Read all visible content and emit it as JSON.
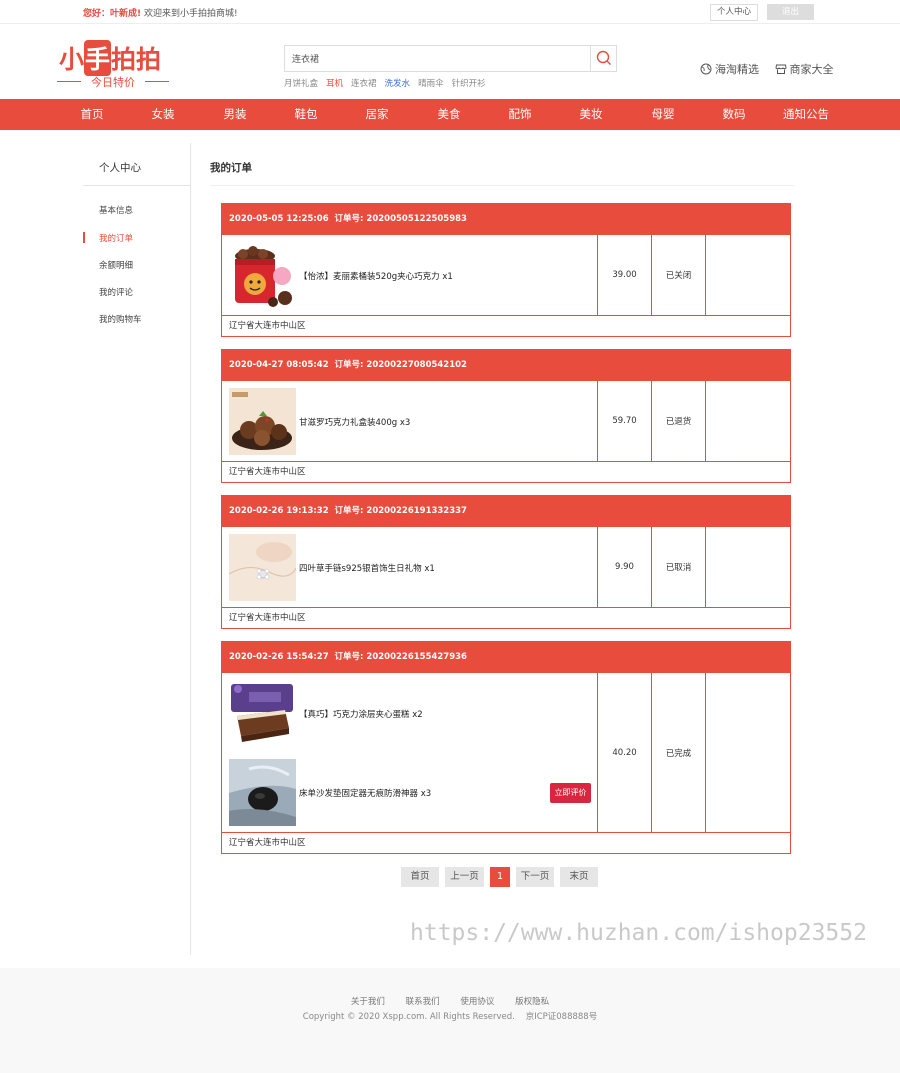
{
  "topbar": {
    "hello": "您好：叶新成!",
    "welcome": "欢迎来到小手拍拍商城!",
    "user_center": "个人中心",
    "logout": "退出"
  },
  "logo": {
    "pre": "小",
    "box": "手",
    "post": "拍拍",
    "sub": "今日特价"
  },
  "search": {
    "value": "连衣裙",
    "hotwords": [
      "月饼礼盒",
      "耳机",
      "连衣裙",
      "洗发水",
      "晴雨伞",
      "针织开衫"
    ]
  },
  "header_links": [
    "海淘精选",
    "商家大全"
  ],
  "nav": [
    "首页",
    "女装",
    "男装",
    "鞋包",
    "居家",
    "美食",
    "配饰",
    "美妆",
    "母婴",
    "数码",
    "通知公告"
  ],
  "sidebar": {
    "title": "个人中心",
    "items": [
      "基本信息",
      "我的订单",
      "余额明细",
      "我的评论",
      "我的购物车"
    ]
  },
  "main": {
    "title": "我的订单"
  },
  "orders": [
    {
      "datetime": "2020-05-05 12:25:06",
      "order_label": "订单号:",
      "order_no": "20200505122505983",
      "items": [
        {
          "name": "【怡浓】麦丽素桶装520g夹心巧克力 x1"
        }
      ],
      "price": "39.00",
      "status": "已关闭",
      "address": "辽宁省大连市中山区"
    },
    {
      "datetime": "2020-04-27 08:05:42",
      "order_label": "订单号:",
      "order_no": "20200227080542102",
      "items": [
        {
          "name": "甘滋罗巧克力礼盒装400g x3"
        }
      ],
      "price": "59.70",
      "status": "已退货",
      "address": "辽宁省大连市中山区"
    },
    {
      "datetime": "2020-02-26 19:13:32",
      "order_label": "订单号:",
      "order_no": "20200226191332337",
      "items": [
        {
          "name": "四叶草手链s925银首饰生日礼物 x1"
        }
      ],
      "price": "9.90",
      "status": "已取消",
      "address": "辽宁省大连市中山区"
    },
    {
      "datetime": "2020-02-26 15:54:27",
      "order_label": "订单号:",
      "order_no": "20200226155427936",
      "items": [
        {
          "name": "【真巧】巧克力涂层夹心蛋糕 x2"
        },
        {
          "name": "床单沙发垫固定器无痕防滑神器 x3",
          "review": "立即评价"
        }
      ],
      "price": "40.20",
      "status": "已完成",
      "address": "辽宁省大连市中山区"
    }
  ],
  "pagination": {
    "first": "首页",
    "prev": "上一页",
    "current": "1",
    "next": "下一页",
    "last": "末页"
  },
  "watermark": "https://www.huzhan.com/ishop23552",
  "footer": {
    "links": [
      "关于我们",
      "联系我们",
      "使用协议",
      "版权隐私"
    ],
    "copyright": "Copyright © 2020 Xspp.com. All Rights Reserved.",
    "icp": "京ICP证088888号"
  },
  "colors": {
    "brand": "#e84c3d",
    "review_button": "#d7263d"
  }
}
